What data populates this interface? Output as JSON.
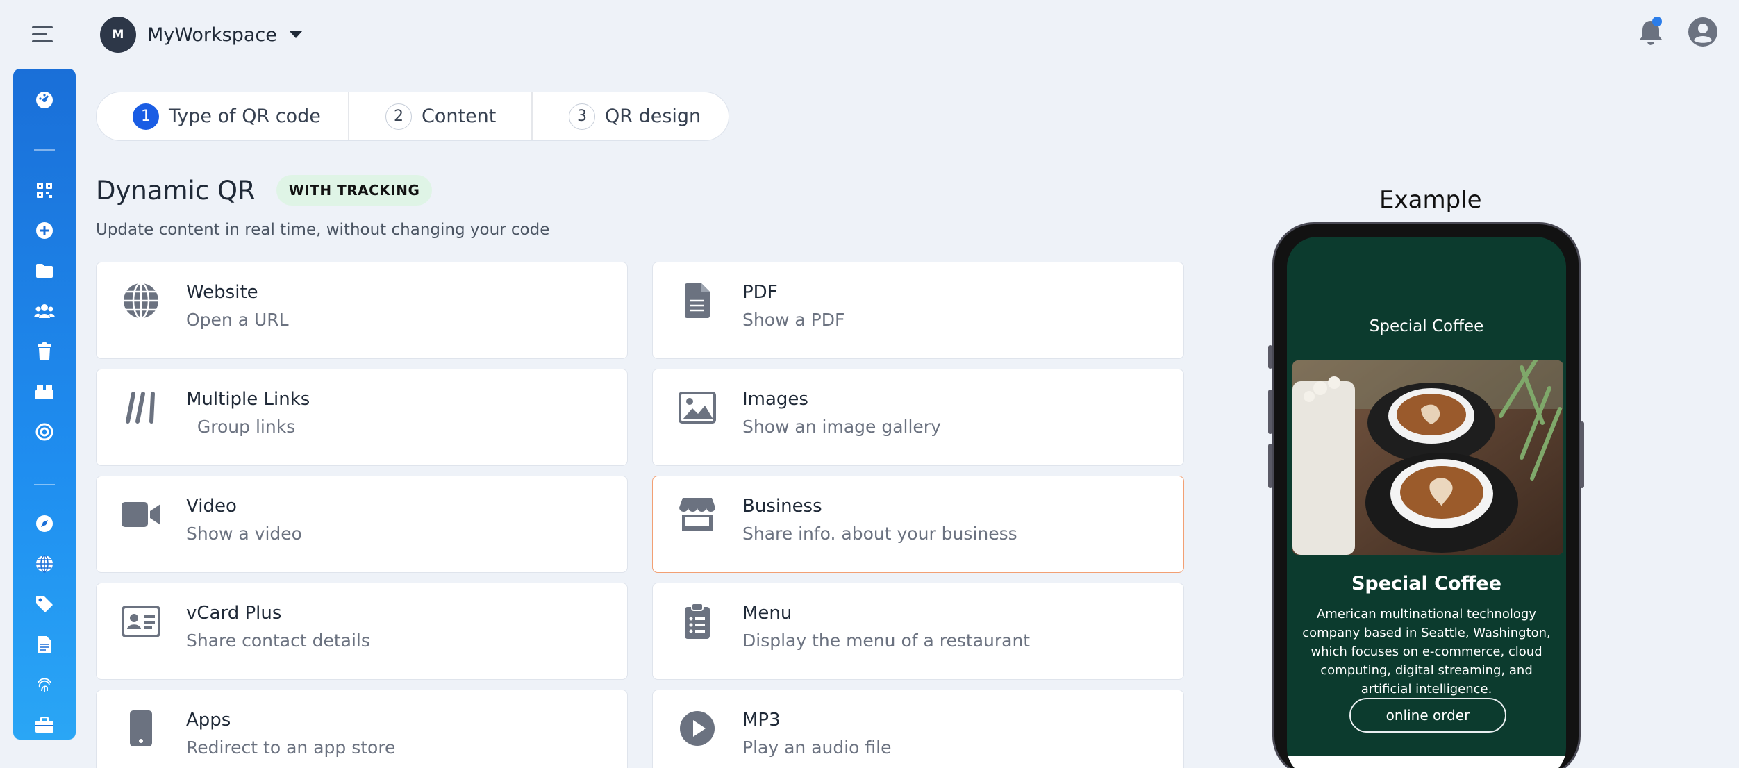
{
  "header": {
    "workspace_initial": "M",
    "workspace_name": "MyWorkspace"
  },
  "stepper": {
    "steps": [
      {
        "num": "1",
        "label": "Type of QR code"
      },
      {
        "num": "2",
        "label": "Content"
      },
      {
        "num": "3",
        "label": "QR design"
      }
    ]
  },
  "main": {
    "title": "Dynamic QR",
    "badge": "WITH TRACKING",
    "subtitle": "Update content in real time, without changing your code",
    "cards": [
      {
        "title": "Website",
        "desc": "Open a URL",
        "icon": "globe-icon"
      },
      {
        "title": "PDF",
        "desc": "Show a PDF",
        "icon": "file-icon"
      },
      {
        "title": "Multiple Links",
        "desc": "  Group links",
        "icon": "links-icon"
      },
      {
        "title": "Images",
        "desc": "Show an image gallery",
        "icon": "image-icon"
      },
      {
        "title": "Video",
        "desc": "Show a video",
        "icon": "video-camera-icon"
      },
      {
        "title": "Business",
        "desc": "Share info. about your business",
        "icon": "store-icon"
      },
      {
        "title": "vCard Plus",
        "desc": "Share contact details",
        "icon": "id-card-icon"
      },
      {
        "title": "Menu",
        "desc": "Display the menu of a restaurant",
        "icon": "clipboard-list-icon"
      },
      {
        "title": "Apps",
        "desc": "Redirect to an app store",
        "icon": "mobile-icon"
      },
      {
        "title": "MP3",
        "desc": "Play an audio file",
        "icon": "play-circle-icon"
      }
    ]
  },
  "example": {
    "label": "Example",
    "screen_header": "Special Coffee",
    "title": "Special Coffee",
    "description": "American multinational technology company based in Seattle, Washington, which focuses on e-commerce, cloud computing, digital streaming, and artificial intelligence.",
    "button": "online order"
  },
  "colors": {
    "accent": "#1a5de4",
    "sidebar": "#1f8ef0",
    "selected_border": "#f2a074",
    "phone_screen": "#0c3b2e",
    "badge_bg": "#dff4e6"
  }
}
